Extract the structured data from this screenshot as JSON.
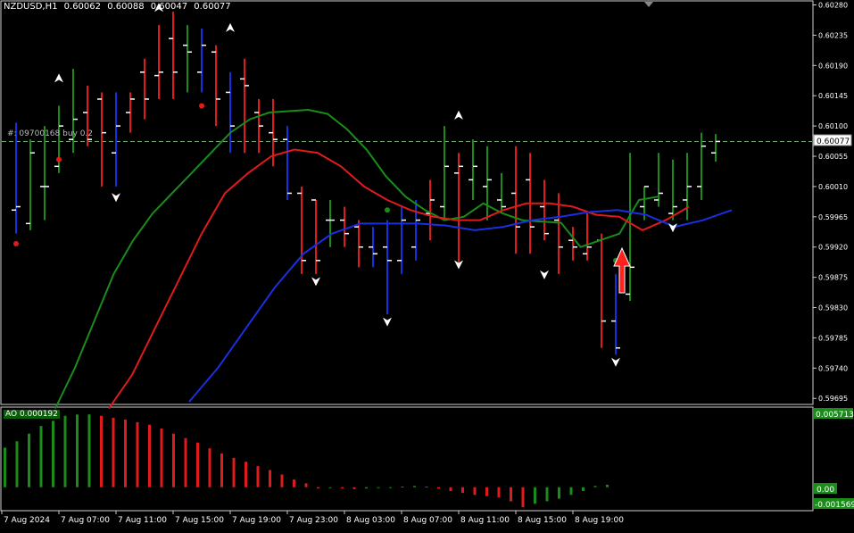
{
  "header": {
    "symbol": "NZDUSD,H1",
    "open": "0.60062",
    "high": "0.60088",
    "low": "0.60047",
    "close": "0.60077"
  },
  "trade_line_label": "#: 09700168 buy 0.2",
  "current_price_label": "0.60077",
  "ao": {
    "label": "AO 0.000192",
    "scale_top": "0.005713",
    "scale_mid": "0.00",
    "scale_bottom": "-0.001569"
  },
  "colors": {
    "bull": "#1a8c1a",
    "bear": "#e01b1b",
    "blue": "#1431e0",
    "green_ma": "#1a8c1a",
    "red_ma": "#e01b1b",
    "blue_ma": "#1a2fe0",
    "arrow": "#ff2020"
  },
  "chart_data": {
    "type": "candlestick",
    "price_axis": [
      "0.60280",
      "0.60235",
      "0.60190",
      "0.60145",
      "0.60100",
      "0.60055",
      "0.60010",
      "0.59965",
      "0.59920",
      "0.59875",
      "0.59830",
      "0.59785",
      "0.59740",
      "0.59695"
    ],
    "price_range": [
      0.5969,
      0.60282
    ],
    "time_axis": [
      "7 Aug 2024",
      "7 Aug 07:00",
      "7 Aug 11:00",
      "7 Aug 15:00",
      "7 Aug 19:00",
      "7 Aug 23:00",
      "8 Aug 03:00",
      "8 Aug 07:00",
      "8 Aug 11:00",
      "8 Aug 15:00",
      "8 Aug 19:00"
    ],
    "bars": [
      {
        "o": 0.59975,
        "h": 0.60105,
        "l": 0.5994,
        "c": 0.5998,
        "k": "b"
      },
      {
        "o": 0.59955,
        "h": 0.6008,
        "l": 0.59945,
        "c": 0.6006,
        "k": "g"
      },
      {
        "o": 0.6001,
        "h": 0.601,
        "l": 0.5996,
        "c": 0.6001,
        "k": "g"
      },
      {
        "o": 0.6004,
        "h": 0.6013,
        "l": 0.6003,
        "c": 0.601,
        "k": "g"
      },
      {
        "o": 0.6008,
        "h": 0.60185,
        "l": 0.6006,
        "c": 0.6011,
        "k": "g"
      },
      {
        "o": 0.6012,
        "h": 0.6016,
        "l": 0.6007,
        "c": 0.6008,
        "k": "r"
      },
      {
        "o": 0.6014,
        "h": 0.6015,
        "l": 0.6001,
        "c": 0.6009,
        "k": "r"
      },
      {
        "o": 0.6006,
        "h": 0.6015,
        "l": 0.6001,
        "c": 0.601,
        "k": "b"
      },
      {
        "o": 0.6012,
        "h": 0.6015,
        "l": 0.6009,
        "c": 0.6014,
        "k": "r"
      },
      {
        "o": 0.6018,
        "h": 0.602,
        "l": 0.6011,
        "c": 0.6014,
        "k": "r"
      },
      {
        "o": 0.60175,
        "h": 0.6025,
        "l": 0.6014,
        "c": 0.6018,
        "k": "r"
      },
      {
        "o": 0.6023,
        "h": 0.6027,
        "l": 0.6014,
        "c": 0.6018,
        "k": "r"
      },
      {
        "o": 0.6022,
        "h": 0.6025,
        "l": 0.6015,
        "c": 0.6021,
        "k": "g"
      },
      {
        "o": 0.6018,
        "h": 0.60245,
        "l": 0.6015,
        "c": 0.6022,
        "k": "b"
      },
      {
        "o": 0.6021,
        "h": 0.6022,
        "l": 0.601,
        "c": 0.6014,
        "k": "r"
      },
      {
        "o": 0.6015,
        "h": 0.6018,
        "l": 0.6006,
        "c": 0.601,
        "k": "b"
      },
      {
        "o": 0.6017,
        "h": 0.602,
        "l": 0.6006,
        "c": 0.6016,
        "k": "r"
      },
      {
        "o": 0.6012,
        "h": 0.6014,
        "l": 0.6006,
        "c": 0.601,
        "k": "r"
      },
      {
        "o": 0.6009,
        "h": 0.6014,
        "l": 0.6004,
        "c": 0.6008,
        "k": "r"
      },
      {
        "o": 0.6008,
        "h": 0.601,
        "l": 0.5999,
        "c": 0.6,
        "k": "b"
      },
      {
        "o": 0.6,
        "h": 0.6001,
        "l": 0.5988,
        "c": 0.599,
        "k": "r"
      },
      {
        "o": 0.5999,
        "h": 0.5999,
        "l": 0.5988,
        "c": 0.599,
        "k": "r"
      },
      {
        "o": 0.5996,
        "h": 0.5999,
        "l": 0.5992,
        "c": 0.5996,
        "k": "g"
      },
      {
        "o": 0.5996,
        "h": 0.5998,
        "l": 0.5992,
        "c": 0.5994,
        "k": "r"
      },
      {
        "o": 0.5995,
        "h": 0.5996,
        "l": 0.5989,
        "c": 0.5992,
        "k": "r"
      },
      {
        "o": 0.5992,
        "h": 0.5995,
        "l": 0.5989,
        "c": 0.5991,
        "k": "b"
      },
      {
        "o": 0.5992,
        "h": 0.5996,
        "l": 0.5982,
        "c": 0.599,
        "k": "b"
      },
      {
        "o": 0.599,
        "h": 0.5998,
        "l": 0.5988,
        "c": 0.5996,
        "k": "b"
      },
      {
        "o": 0.5992,
        "h": 0.5999,
        "l": 0.599,
        "c": 0.5996,
        "k": "b"
      },
      {
        "o": 0.5997,
        "h": 0.6002,
        "l": 0.5993,
        "c": 0.5999,
        "k": "r"
      },
      {
        "o": 0.5998,
        "h": 0.601,
        "l": 0.5996,
        "c": 0.6004,
        "k": "g"
      },
      {
        "o": 0.6003,
        "h": 0.6006,
        "l": 0.5989,
        "c": 0.6004,
        "k": "r"
      },
      {
        "o": 0.6002,
        "h": 0.6008,
        "l": 0.5999,
        "c": 0.6004,
        "k": "g"
      },
      {
        "o": 0.6001,
        "h": 0.6007,
        "l": 0.5996,
        "c": 0.6002,
        "k": "g"
      },
      {
        "o": 0.5999,
        "h": 0.6003,
        "l": 0.5997,
        "c": 0.5998,
        "k": "g"
      },
      {
        "o": 0.6,
        "h": 0.6007,
        "l": 0.5991,
        "c": 0.5995,
        "k": "r"
      },
      {
        "o": 0.6002,
        "h": 0.6006,
        "l": 0.5991,
        "c": 0.5995,
        "k": "r"
      },
      {
        "o": 0.5998,
        "h": 0.6002,
        "l": 0.5993,
        "c": 0.5994,
        "k": "r"
      },
      {
        "o": 0.5996,
        "h": 0.6,
        "l": 0.5988,
        "c": 0.5992,
        "k": "r"
      },
      {
        "o": 0.5993,
        "h": 0.5995,
        "l": 0.599,
        "c": 0.5992,
        "k": "r"
      },
      {
        "o": 0.5991,
        "h": 0.5997,
        "l": 0.599,
        "c": 0.5992,
        "k": "r"
      },
      {
        "o": 0.5993,
        "h": 0.5994,
        "l": 0.5977,
        "c": 0.5981,
        "k": "r"
      },
      {
        "o": 0.5981,
        "h": 0.5988,
        "l": 0.5976,
        "c": 0.5977,
        "k": "b"
      },
      {
        "o": 0.5985,
        "h": 0.6006,
        "l": 0.5984,
        "c": 0.5989,
        "k": "g"
      },
      {
        "o": 0.5998,
        "h": 0.6001,
        "l": 0.5996,
        "c": 0.6001,
        "k": "g"
      },
      {
        "o": 0.5999,
        "h": 0.6006,
        "l": 0.5998,
        "c": 0.6,
        "k": "g"
      },
      {
        "o": 0.5997,
        "h": 0.6005,
        "l": 0.5996,
        "c": 0.5998,
        "k": "g"
      },
      {
        "o": 0.5999,
        "h": 0.6006,
        "l": 0.5996,
        "c": 0.6001,
        "k": "g"
      },
      {
        "o": 0.6001,
        "h": 0.6009,
        "l": 0.5999,
        "c": 0.6007,
        "k": "g"
      },
      {
        "o": 0.6006,
        "h": 0.60088,
        "l": 0.60047,
        "c": 0.60077,
        "k": "g"
      }
    ],
    "ma_green": [
      0.5968,
      0.5974,
      0.5981,
      0.5988,
      0.5993,
      0.5997,
      0.6,
      0.6003,
      0.6006,
      0.6009,
      0.6011,
      0.6012,
      0.60122,
      0.60124,
      0.60118,
      0.60095,
      0.60065,
      0.60025,
      0.59995,
      0.59975,
      0.5996,
      0.59965,
      0.59985,
      0.5997,
      0.5996,
      0.59958,
      0.59956,
      0.5992,
      0.5993,
      0.5994,
      0.5999,
      0.59995
    ],
    "ma_red": [
      0.5968,
      0.5973,
      0.598,
      0.5987,
      0.5994,
      0.6,
      0.6003,
      0.60055,
      0.60065,
      0.6006,
      0.6004,
      0.6001,
      0.5999,
      0.59975,
      0.59965,
      0.5996,
      0.5996,
      0.59975,
      0.59985,
      0.59985,
      0.5998,
      0.59968,
      0.59965,
      0.59945,
      0.5996,
      0.5998
    ],
    "ma_blue": [
      0.5969,
      0.5974,
      0.598,
      0.5986,
      0.5991,
      0.5994,
      0.59955,
      0.59955,
      0.59955,
      0.59952,
      0.59945,
      0.5995,
      0.5996,
      0.59965,
      0.59972,
      0.59975,
      0.59968,
      0.5995,
      0.5996,
      0.59975
    ],
    "ao_values": [
      0.0031,
      0.0036,
      0.0042,
      0.0048,
      0.0052,
      0.0056,
      0.0057,
      0.00571,
      0.0056,
      0.00545,
      0.0053,
      0.0051,
      0.0049,
      0.0046,
      0.0042,
      0.00385,
      0.0035,
      0.00305,
      0.00265,
      0.0023,
      0.002,
      0.00165,
      0.00135,
      0.001,
      0.0006,
      0.0003,
      -0.0001,
      -5e-05,
      -0.0001,
      -0.00015,
      -0.0001,
      -5e-05,
      -5e-05,
      5e-05,
      0.0001,
      5e-05,
      -0.0001,
      -0.0003,
      -0.00045,
      -0.0006,
      -0.0007,
      -0.0008,
      -0.0011,
      -0.00157,
      -0.0013,
      -0.0011,
      -0.0009,
      -0.0006,
      -0.0003,
      0.0001,
      0.000192
    ],
    "ao_range": [
      -0.0017,
      0.006
    ],
    "buy_level": 0.60077,
    "up_arrows": [
      {
        "bar": 3,
        "price": 0.6017
      },
      {
        "bar": 10,
        "price": 0.60275
      },
      {
        "bar": 15,
        "price": 0.60245
      },
      {
        "bar": 31,
        "price": 0.60115
      }
    ],
    "down_arrows": [
      {
        "bar": 7,
        "price": 0.59995
      },
      {
        "bar": 21,
        "price": 0.5987
      },
      {
        "bar": 26,
        "price": 0.5981
      },
      {
        "bar": 31,
        "price": 0.59895
      },
      {
        "bar": 37,
        "price": 0.5988
      },
      {
        "bar": 42,
        "price": 0.5975
      },
      {
        "bar": 46,
        "price": 0.5995
      }
    ],
    "dots": [
      {
        "bar": 0,
        "price": 0.59925,
        "k": "r"
      },
      {
        "bar": 3,
        "price": 0.6005,
        "k": "r"
      },
      {
        "bar": 13,
        "price": 0.6013,
        "k": "r"
      },
      {
        "bar": 26,
        "price": 0.59975,
        "k": "g"
      },
      {
        "bar": 42,
        "price": 0.599,
        "k": "g"
      }
    ]
  }
}
